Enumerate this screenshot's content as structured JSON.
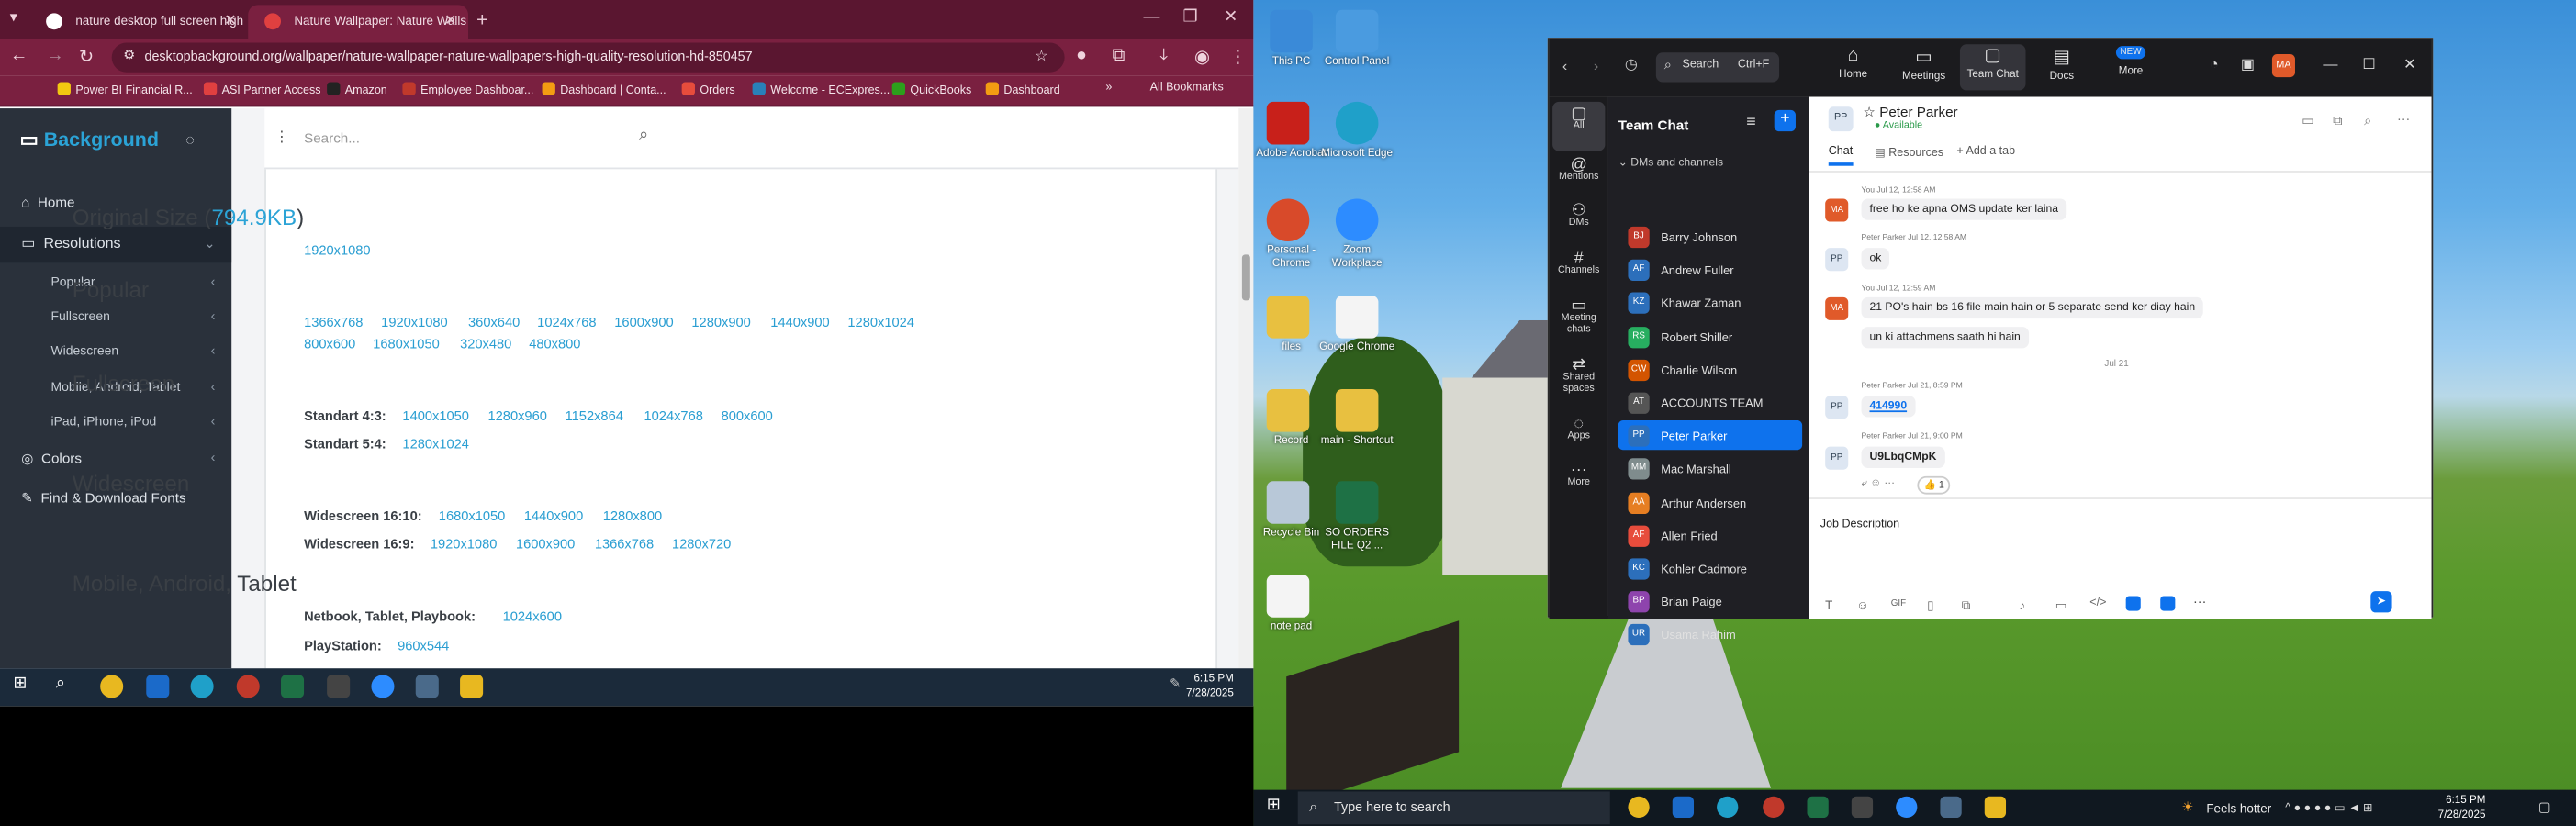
{
  "browser": {
    "tabs": [
      {
        "title": "nature desktop full screen high"
      },
      {
        "title": "Nature Wallpaper: Nature Walls"
      }
    ],
    "url": "desktopbackground.org/wallpaper/nature-wallpaper-nature-wallpapers-high-quality-resolution-hd-850457",
    "bookmarks": [
      "Power BI Financial R...",
      "ASI Partner Access",
      "Amazon",
      "Employee Dashboar...",
      "Dashboard | Conta...",
      "Orders",
      "Welcome - ECExpres...",
      "QuickBooks",
      "Dashboard"
    ],
    "all_bookmarks": "All Bookmarks"
  },
  "site": {
    "logo": "Background",
    "nav": {
      "home": "Home",
      "resolutions": "Resolutions",
      "sub": [
        "Popular",
        "Fullscreen",
        "Widescreen",
        "Mobile, Android, Tablet",
        "iPad, iPhone, iPod"
      ],
      "colors": "Colors",
      "fonts": "Find & Download Fonts"
    },
    "search_placeholder": "Search...",
    "original_title": "Original Size (",
    "original_size": "794.9KB",
    "original_close": ")",
    "original_res": "1920x1080",
    "popular_title": "Popular",
    "popular_row1": [
      "1366x768",
      "1920x1080",
      "360x640",
      "1024x768",
      "1600x900",
      "1280x900",
      "1440x900",
      "1280x1024"
    ],
    "popular_row2": [
      "800x600",
      "1680x1050",
      "320x480",
      "480x800"
    ],
    "fullscreen_title": "Fullscreen",
    "std43_label": "Standart 4:3:",
    "std43": [
      "1400x1050",
      "1280x960",
      "1152x864",
      "1024x768",
      "800x600"
    ],
    "std54_label": "Standart 5:4:",
    "std54": [
      "1280x1024"
    ],
    "widescreen_title": "Widescreen",
    "ws1610_label": "Widescreen 16:10:",
    "ws1610": [
      "1680x1050",
      "1440x900",
      "1280x800"
    ],
    "ws169_label": "Widescreen 16:9:",
    "ws169": [
      "1920x1080",
      "1600x900",
      "1366x768",
      "1280x720"
    ],
    "mobile_title": "Mobile, Android, Tablet",
    "netbook_label": "Netbook, Tablet, Playbook:",
    "netbook": [
      "1024x600"
    ],
    "ps_label": "PlayStation:",
    "ps": [
      "960x544"
    ]
  },
  "taskbar_left": {
    "time": "6:15 PM",
    "date": "7/28/2025"
  },
  "desktop": {
    "icons": [
      "This PC",
      "Control Panel",
      "Adobe Acrobat",
      "Microsoft Edge",
      "Personal - Chrome",
      "Zoom Workplace",
      "files",
      "Google Chrome",
      "Record",
      "main - Shortcut",
      "Recycle Bin",
      "SO ORDERS FILE Q2 ...",
      "note pad"
    ],
    "search_placeholder": "Type here to search",
    "weather": "Feels hotter",
    "time": "6:15 PM",
    "date": "7/28/2025"
  },
  "zoom": {
    "search": "Search",
    "shortcut": "Ctrl+F",
    "top_nav": [
      "Home",
      "Meetings",
      "Team Chat",
      "Docs",
      "More"
    ],
    "new_badge": "NEW",
    "user_initials": "MA",
    "rail": [
      "All",
      "Mentions",
      "DMs",
      "Channels",
      "Meeting chats",
      "Shared spaces",
      "Apps",
      "More"
    ],
    "list_title": "Team Chat",
    "section": "DMs and channels",
    "contacts": [
      {
        "initials": "BJ",
        "name": "Barry Johnson",
        "color": "#c0392b"
      },
      {
        "initials": "AF",
        "name": "Andrew Fuller",
        "color": "#2c6fbb"
      },
      {
        "initials": "KZ",
        "name": "Khawar Zaman",
        "color": "#2c6fbb"
      },
      {
        "initials": "RS",
        "name": "Robert Shiller",
        "color": "#27ae60"
      },
      {
        "initials": "CW",
        "name": "Charlie Wilson",
        "color": "#d35400"
      },
      {
        "initials": "AT",
        "name": "ACCOUNTS TEAM",
        "color": "#555555"
      },
      {
        "initials": "PP",
        "name": "Peter Parker",
        "color": "#2c6fbb"
      },
      {
        "initials": "MM",
        "name": "Mac Marshall",
        "color": "#7f8c8d"
      },
      {
        "initials": "AA",
        "name": "Arthur Andersen",
        "color": "#e67e22"
      },
      {
        "initials": "AF",
        "name": "Allen Fried",
        "color": "#e74c3c"
      },
      {
        "initials": "KC",
        "name": "Kohler Cadmore",
        "color": "#2c6fbb"
      },
      {
        "initials": "BP",
        "name": "Brian Paige",
        "color": "#8e44ad"
      },
      {
        "initials": "UR",
        "name": "Usama Rahim",
        "color": "#2c6fbb"
      }
    ],
    "chat_name": "Peter Parker",
    "chat_initials": "PP",
    "status": "Available",
    "chat_tabs": [
      "Chat",
      "Resources",
      "Add a tab"
    ],
    "messages": [
      {
        "meta": "You Jul 12, 12:58 AM",
        "av": "MA",
        "text": "free ho ke apna OMS update ker laina"
      },
      {
        "meta": "Peter Parker Jul 12, 12:58 AM",
        "av": "PP",
        "text": "ok"
      },
      {
        "meta": "You Jul 12, 12:59 AM",
        "av": "MA",
        "text": "21 PO's hain bs 16 file main hain or 5 separate send ker diay hain"
      },
      {
        "meta": "",
        "av": "",
        "text": "un ki attachmens saath hi hain"
      },
      {
        "meta": "Peter Parker Jul 21, 8:59 PM",
        "av": "PP",
        "text": "414990"
      },
      {
        "meta": "Peter Parker Jul 21, 9:00 PM",
        "av": "PP",
        "text": "U9LbqCMpK"
      }
    ],
    "date_divider": "Jul 21",
    "reaction": "👍 1",
    "compose": "Job Description"
  }
}
